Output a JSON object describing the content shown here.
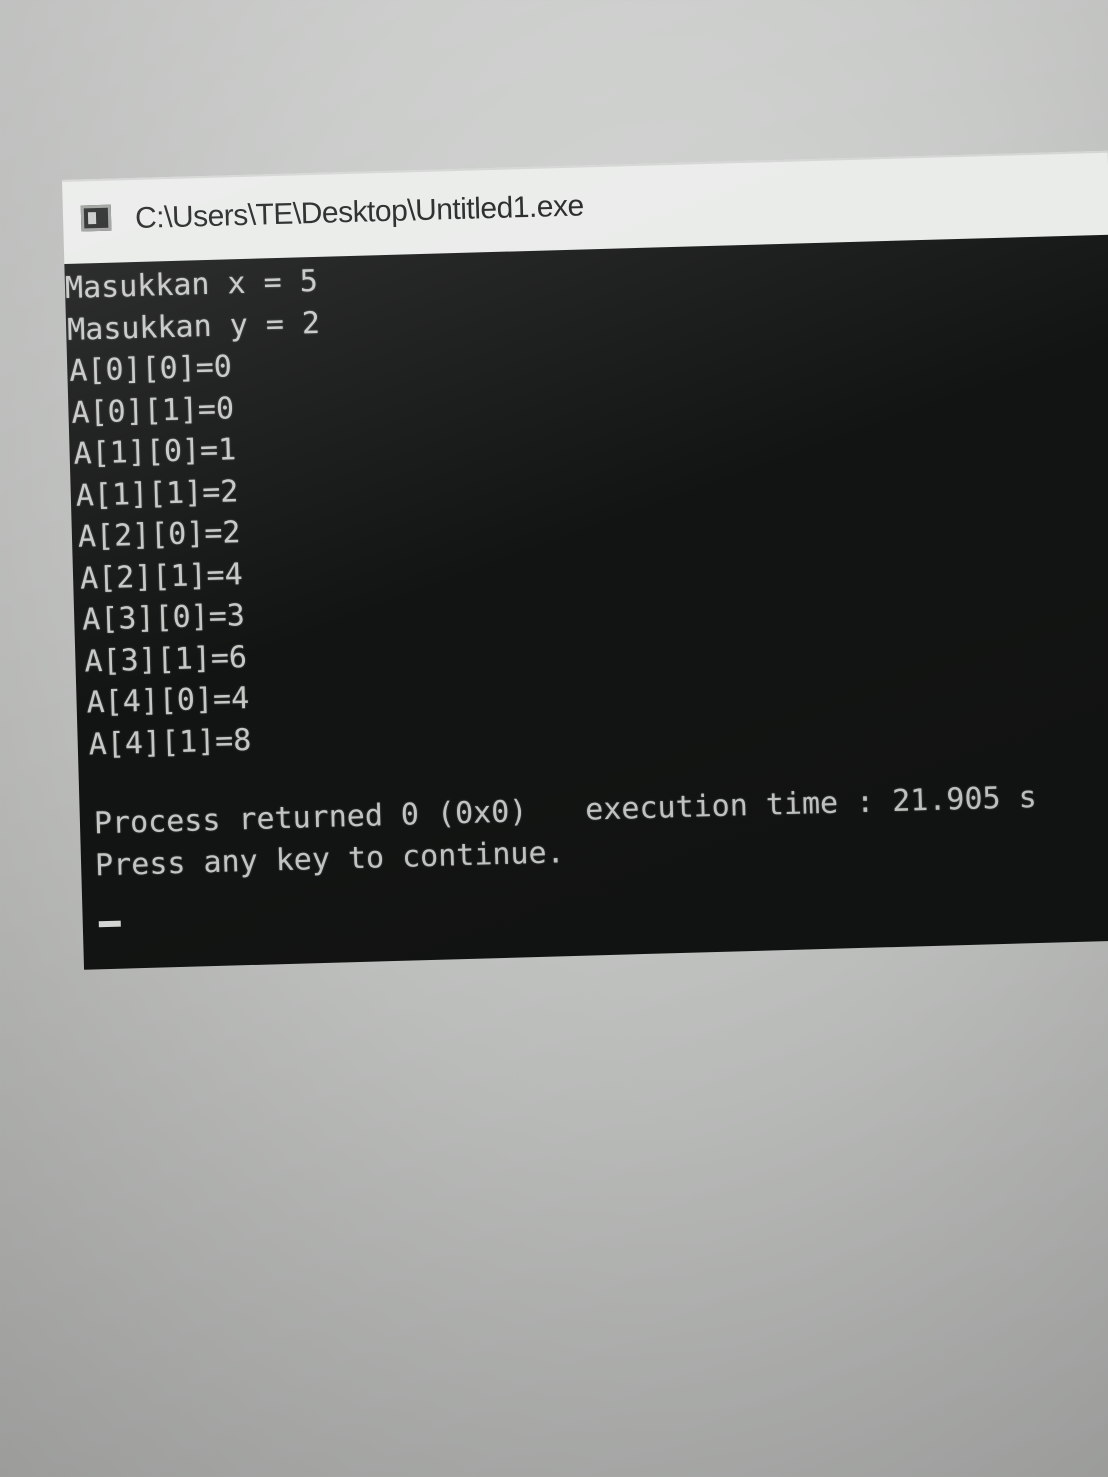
{
  "window": {
    "title": "C:\\Users\\TE\\Desktop\\Untitled1.exe",
    "icon": "console-icon"
  },
  "console": {
    "input_lines": [
      "Masukkan x = 5",
      "Masukkan y = 2"
    ],
    "output_lines": [
      "A[0][0]=0",
      "A[0][1]=0",
      "A[1][0]=1",
      "A[1][1]=2",
      "A[2][0]=2",
      "A[2][1]=4",
      "A[3][0]=3",
      "A[3][1]=6",
      "A[4][0]=4",
      "A[4][1]=8"
    ],
    "process_returned": "Process returned 0 (0x0)",
    "execution_time": "execution time : 21.905 s",
    "press_key": "Press any key to continue."
  },
  "colors": {
    "console_background": "#121413",
    "console_text": "#c6c8c5",
    "title_bar": "#e9ebe9"
  }
}
